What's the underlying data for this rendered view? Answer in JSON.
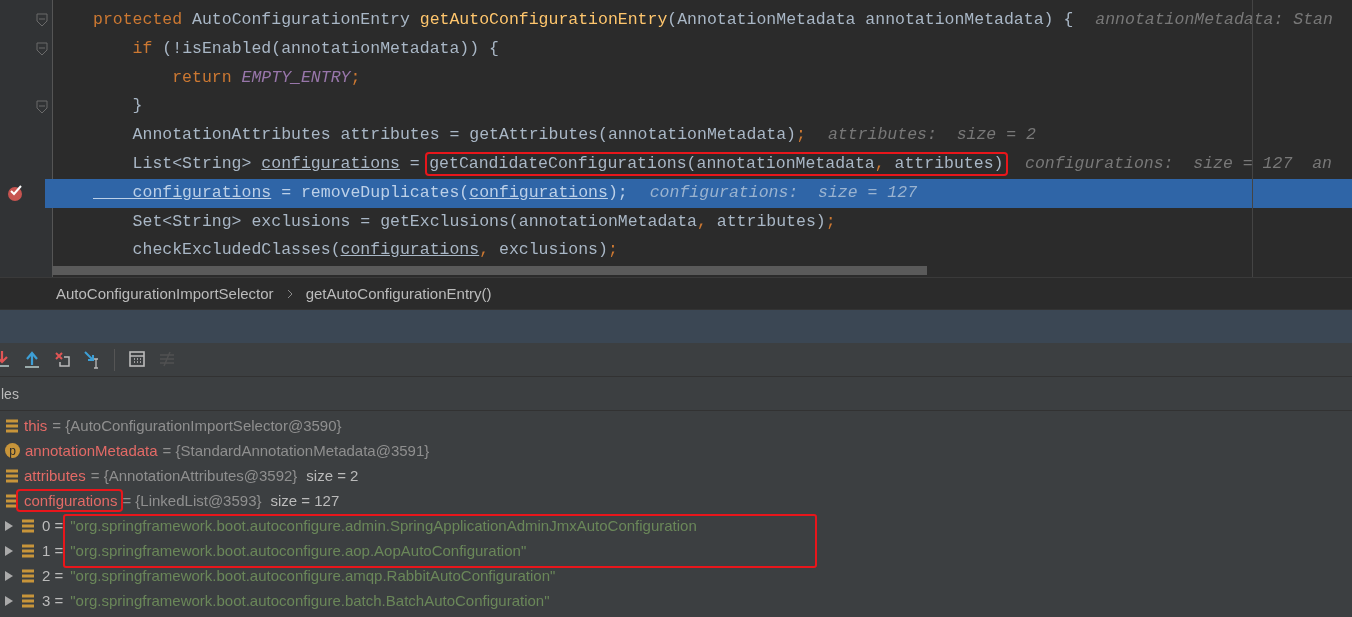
{
  "editor": {
    "lines": [
      {
        "fold": true,
        "breakpoint": false,
        "highlighted": false,
        "tokens": [
          {
            "text": "protected",
            "kind": "keyword"
          },
          {
            "text": " AutoConfigurationEntry ",
            "kind": "plain"
          },
          {
            "text": "getAutoConfigurationEntry",
            "kind": "method"
          },
          {
            "text": "(AnnotationMetadata annotationMetadata) {",
            "kind": "plain"
          }
        ],
        "hint": "annotationMetadata: Stan"
      },
      {
        "fold": true,
        "breakpoint": false,
        "highlighted": false,
        "tokens": [
          {
            "text": "    if",
            "kind": "keyword"
          },
          {
            "text": " (!isEnabled(annotationMetadata)) {",
            "kind": "plain"
          }
        ]
      },
      {
        "fold": false,
        "breakpoint": false,
        "highlighted": false,
        "tokens": [
          {
            "text": "        return ",
            "kind": "keyword"
          },
          {
            "text": "EMPTY_ENTRY",
            "kind": "constant"
          },
          {
            "text": ";",
            "kind": "punct"
          }
        ]
      },
      {
        "fold": true,
        "breakpoint": false,
        "highlighted": false,
        "tokens": [
          {
            "text": "    }",
            "kind": "plain"
          }
        ]
      },
      {
        "fold": false,
        "breakpoint": false,
        "highlighted": false,
        "tokens": [
          {
            "text": "    AnnotationAttributes attributes = getAttributes(annotationMetadata)",
            "kind": "plain"
          },
          {
            "text": ";",
            "kind": "punct"
          }
        ],
        "hint": "attributes:  size = 2"
      },
      {
        "fold": false,
        "breakpoint": false,
        "highlighted": false,
        "tokens": [
          {
            "text": "    List<String> ",
            "kind": "plain"
          },
          {
            "text": "configurations",
            "kind": "variable"
          },
          {
            "text": " = ",
            "kind": "plain"
          },
          {
            "text": "getCandidateConfigurations(annotationMetadata",
            "kind": "plain",
            "outlined": true
          },
          {
            "text": ", ",
            "kind": "punct",
            "outlined": true
          },
          {
            "text": "attributes)",
            "kind": "plain",
            "outlined": true
          }
        ],
        "hint": "configurations:  size = 127  an"
      },
      {
        "fold": false,
        "breakpoint": true,
        "highlighted": true,
        "tokens": [
          {
            "text": "    configurations",
            "kind": "variable"
          },
          {
            "text": " = removeDuplicates(",
            "kind": "plain"
          },
          {
            "text": "configurations",
            "kind": "variable"
          },
          {
            "text": ")",
            "kind": "plain"
          },
          {
            "text": ";",
            "kind": "punct"
          }
        ],
        "hint": "configurations:  size = 127"
      },
      {
        "fold": false,
        "breakpoint": false,
        "highlighted": false,
        "tokens": [
          {
            "text": "    Set<String> exclusions = getExclusions(annotationMetadata",
            "kind": "plain"
          },
          {
            "text": ", ",
            "kind": "punct"
          },
          {
            "text": "attributes)",
            "kind": "plain"
          },
          {
            "text": ";",
            "kind": "punct"
          }
        ]
      },
      {
        "fold": false,
        "breakpoint": false,
        "highlighted": false,
        "tokens": [
          {
            "text": "    checkExcludedClasses(",
            "kind": "plain"
          },
          {
            "text": "configurations",
            "kind": "variable"
          },
          {
            "text": ", ",
            "kind": "punct"
          },
          {
            "text": "exclusions)",
            "kind": "plain"
          },
          {
            "text": ";",
            "kind": "punct"
          }
        ]
      }
    ]
  },
  "breadcrumbs": [
    "AutoConfigurationImportSelector",
    "getAutoConfigurationEntry()"
  ],
  "toolbar": [
    {
      "kind": "step-down"
    },
    {
      "kind": "step-out"
    },
    {
      "kind": "drop-frame"
    },
    {
      "kind": "run-to-cursor"
    },
    {
      "kind": "separator"
    },
    {
      "kind": "evaluate"
    },
    {
      "kind": "trace",
      "disabled": true
    }
  ],
  "variables": {
    "title": "les",
    "items": [
      {
        "kind": "field",
        "name": "this",
        "value": "= {AutoConfigurationImportSelector@3590}",
        "outlined": false
      },
      {
        "kind": "parameter",
        "icon_letter": "p",
        "name": "annotationMetadata",
        "value": "= {StandardAnnotationMetadata@3591}",
        "outlined": false
      },
      {
        "kind": "field",
        "name": "attributes",
        "value": "= {AnnotationAttributes@3592}",
        "extra": "size = 2",
        "outlined": false
      },
      {
        "kind": "field",
        "name": "configurations",
        "value": "= {LinkedList@3593}",
        "extra": "size = 127",
        "outlined": true,
        "children": [
          {
            "index": "0 =",
            "value": "\"org.springframework.boot.autoconfigure.admin.SpringApplicationAdminJmxAutoConfiguration",
            "expanded": false,
            "outlined": true
          },
          {
            "index": "1 =",
            "value": "\"org.springframework.boot.autoconfigure.aop.AopAutoConfiguration\"",
            "expanded": false,
            "outlined": true
          },
          {
            "index": "2 =",
            "value": "\"org.springframework.boot.autoconfigure.amqp.RabbitAutoConfiguration\"",
            "expanded": false,
            "outlined": false
          },
          {
            "index": "3 =",
            "value": "\"org.springframework.boot.autoconfigure.batch.BatchAutoConfiguration\"",
            "expanded": false,
            "outlined": false
          }
        ]
      }
    ]
  }
}
